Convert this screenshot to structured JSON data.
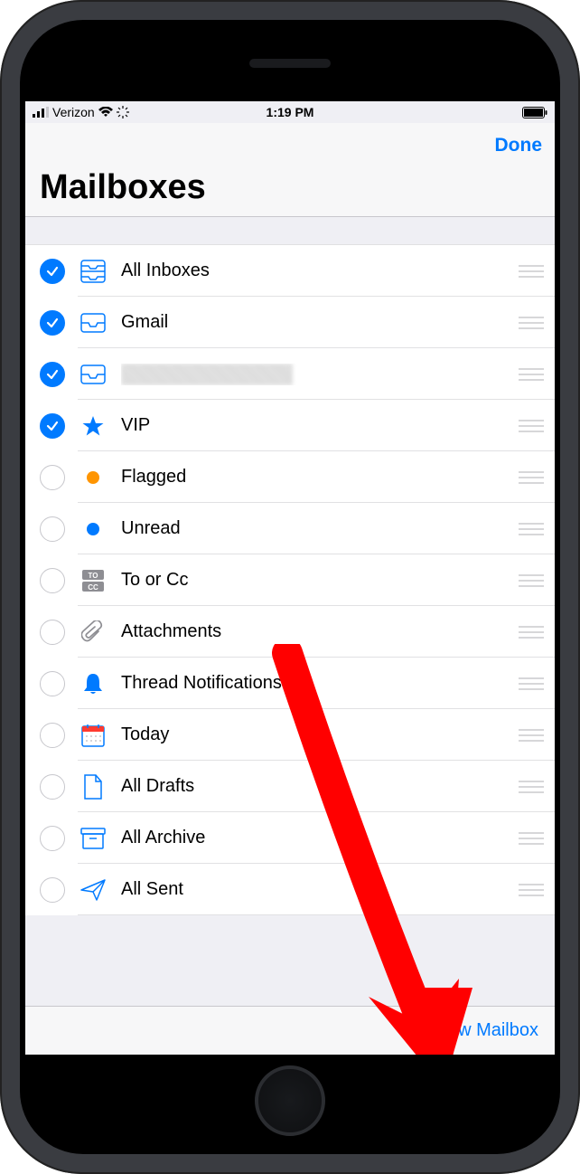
{
  "statusbar": {
    "carrier": "Verizon",
    "time": "1:19 PM"
  },
  "nav": {
    "done": "Done",
    "title": "Mailboxes"
  },
  "toolbar": {
    "new_mailbox": "New Mailbox"
  },
  "mailboxes": [
    {
      "id": "all-inboxes",
      "label": "All Inboxes",
      "checked": true,
      "icon": "stacked-tray",
      "redacted": false
    },
    {
      "id": "gmail",
      "label": "Gmail",
      "checked": true,
      "icon": "tray",
      "redacted": false
    },
    {
      "id": "redacted",
      "label": "",
      "checked": true,
      "icon": "tray",
      "redacted": true
    },
    {
      "id": "vip",
      "label": "VIP",
      "checked": true,
      "icon": "star",
      "redacted": false
    },
    {
      "id": "flagged",
      "label": "Flagged",
      "checked": false,
      "icon": "dot-orange",
      "redacted": false
    },
    {
      "id": "unread",
      "label": "Unread",
      "checked": false,
      "icon": "dot-blue",
      "redacted": false
    },
    {
      "id": "to-cc",
      "label": "To or Cc",
      "checked": false,
      "icon": "tocc",
      "redacted": false
    },
    {
      "id": "attachments",
      "label": "Attachments",
      "checked": false,
      "icon": "paperclip",
      "redacted": false
    },
    {
      "id": "thread",
      "label": "Thread Notifications",
      "checked": false,
      "icon": "bell",
      "redacted": false
    },
    {
      "id": "today",
      "label": "Today",
      "checked": false,
      "icon": "calendar",
      "redacted": false
    },
    {
      "id": "drafts",
      "label": "All Drafts",
      "checked": false,
      "icon": "draft",
      "redacted": false
    },
    {
      "id": "archive",
      "label": "All Archive",
      "checked": false,
      "icon": "archive",
      "redacted": false
    },
    {
      "id": "sent",
      "label": "All Sent",
      "checked": false,
      "icon": "sent",
      "redacted": false
    }
  ]
}
